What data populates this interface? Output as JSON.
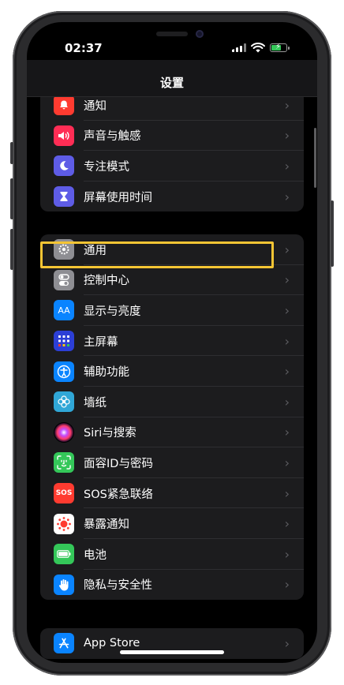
{
  "status_bar": {
    "time": "02:37"
  },
  "nav": {
    "title": "设置"
  },
  "colors": {
    "highlight": "#f5c534",
    "group_bg": "#1c1c1e",
    "screen_bg": "#000000"
  },
  "groups": [
    {
      "id": "notifications",
      "items": [
        {
          "label": "通知",
          "icon": "bell-icon",
          "icon_color": "#ff3b30",
          "glyph": "🔔"
        },
        {
          "label": "声音与触感",
          "icon": "speaker-icon",
          "icon_color": "#ff2d55",
          "glyph": "🔊"
        },
        {
          "label": "专注模式",
          "icon": "moon-icon",
          "icon_color": "#5e5ce6",
          "glyph": "☾"
        },
        {
          "label": "屏幕使用时间",
          "icon": "hourglass-icon",
          "icon_color": "#5e5ce6",
          "glyph": "⧗"
        }
      ]
    },
    {
      "id": "general",
      "items": [
        {
          "label": "通用",
          "icon": "gear-icon",
          "icon_color": "#8e8e93",
          "glyph": "⚙"
        },
        {
          "label": "控制中心",
          "icon": "toggles-icon",
          "icon_color": "#8e8e93",
          "glyph": "◉"
        },
        {
          "label": "显示与亮度",
          "icon": "text-size-icon",
          "icon_color": "#0a84ff",
          "glyph": "AA"
        },
        {
          "label": "主屏幕",
          "icon": "home-grid-icon",
          "icon_color": "#2c3fd6",
          "glyph": "▦"
        },
        {
          "label": "辅助功能",
          "icon": "accessibility-icon",
          "icon_color": "#0a84ff",
          "glyph": "♿"
        },
        {
          "label": "墙纸",
          "icon": "flower-icon",
          "icon_color": "#30a7d7",
          "glyph": "✿"
        },
        {
          "label": "Siri与搜索",
          "icon": "siri-icon",
          "icon_color": "#2a1a3a",
          "glyph": "●"
        },
        {
          "label": "面容ID与密码",
          "icon": "face-id-icon",
          "icon_color": "#34c759",
          "glyph": "☺"
        },
        {
          "label": "SOS紧急联络",
          "icon": "sos-icon",
          "icon_color": "#ff3b30",
          "glyph": "SOS"
        },
        {
          "label": "暴露通知",
          "icon": "exposure-icon",
          "icon_color": "#ffffff",
          "glyph": "✹"
        },
        {
          "label": "电池",
          "icon": "battery-icon",
          "icon_color": "#34c759",
          "glyph": "▭"
        },
        {
          "label": "隐私与安全性",
          "icon": "hand-icon",
          "icon_color": "#0a84ff",
          "glyph": "✋"
        }
      ]
    },
    {
      "id": "store",
      "items": [
        {
          "label": "App Store",
          "icon": "app-store-icon",
          "icon_color": "#0a84ff",
          "glyph": "A"
        }
      ]
    }
  ]
}
